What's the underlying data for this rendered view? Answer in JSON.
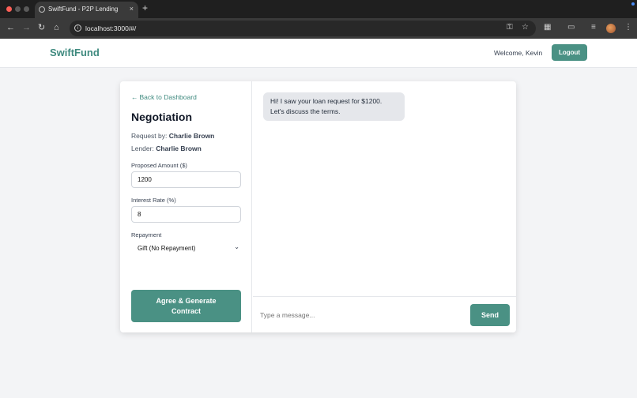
{
  "browser": {
    "tab_title": "SwiftFund - P2P Lending",
    "tab_close": "×",
    "new_tab": "+",
    "url": "localhost:3000/#/",
    "icons": [
      "back-icon",
      "forward-icon",
      "reload-icon",
      "home-icon",
      "site-info-icon",
      "password-key-icon",
      "bookmark-star-icon",
      "extensions-icon",
      "cast-icon",
      "reading-list-icon",
      "profile-avatar",
      "menu-icon"
    ]
  },
  "header": {
    "brand": "SwiftFund",
    "welcome": "Welcome, Kevin",
    "logout": "Logout"
  },
  "negotiation": {
    "back_link": "Back to Dashboard",
    "title": "Negotiation",
    "request_by_label": "Request by:",
    "request_by": "Charlie Brown",
    "lender_label": "Lender:",
    "lender": "Charlie Brown",
    "amount_label": "Proposed Amount ($)",
    "amount_value": "1200",
    "rate_label": "Interest Rate (%)",
    "rate_value": "8",
    "repayment_label": "Repayment",
    "repayment_value": "Gift (No Repayment)",
    "agree_button": "Agree & Generate Contract"
  },
  "chat": {
    "messages": [
      {
        "text": "Hi! I saw your loan request for $1200. Let's discuss the terms."
      }
    ],
    "placeholder": "Type a message...",
    "send": "Send"
  },
  "colors": {
    "accent": "#4a9184",
    "brand": "#3f8a7f",
    "background": "#f3f4f6"
  }
}
